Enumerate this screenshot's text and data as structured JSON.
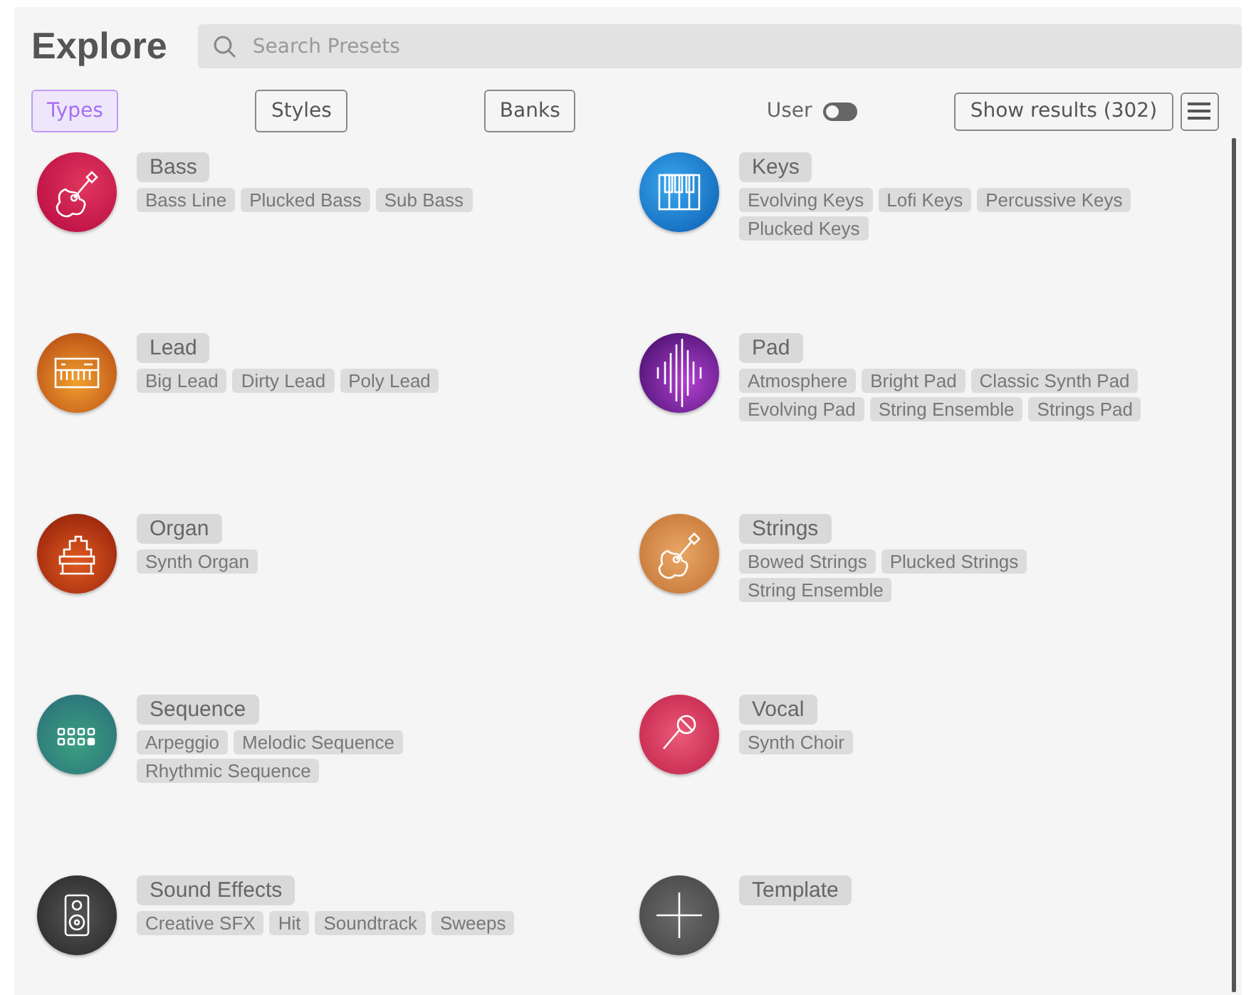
{
  "title": "Explore",
  "search": {
    "placeholder": "Search Presets"
  },
  "filters": [
    {
      "label": "Types",
      "selected": true
    },
    {
      "label": "Styles",
      "selected": false
    },
    {
      "label": "Banks",
      "selected": false
    }
  ],
  "user_toggle": {
    "label": "User",
    "on": false
  },
  "show_results": "Show results (302)",
  "categories": [
    {
      "name": "Bass",
      "kind": "bass",
      "tags": [
        "Bass Line",
        "Plucked Bass",
        "Sub Bass"
      ]
    },
    {
      "name": "Keys",
      "kind": "keys",
      "tags": [
        "Evolving Keys",
        "Lofi Keys",
        "Percussive Keys",
        "Plucked Keys"
      ]
    },
    {
      "name": "Lead",
      "kind": "lead",
      "tags": [
        "Big Lead",
        "Dirty Lead",
        "Poly Lead"
      ]
    },
    {
      "name": "Pad",
      "kind": "pad",
      "tags": [
        "Atmosphere",
        "Bright Pad",
        "Classic Synth Pad",
        "Evolving Pad",
        "String Ensemble",
        "Strings Pad"
      ]
    },
    {
      "name": "Organ",
      "kind": "organ",
      "tags": [
        "Synth Organ"
      ]
    },
    {
      "name": "Strings",
      "kind": "strings",
      "tags": [
        "Bowed Strings",
        "Plucked Strings",
        "String Ensemble"
      ]
    },
    {
      "name": "Sequence",
      "kind": "sequence",
      "tags": [
        "Arpeggio",
        "Melodic Sequence",
        "Rhythmic Sequence"
      ]
    },
    {
      "name": "Vocal",
      "kind": "vocal",
      "tags": [
        "Synth Choir"
      ]
    },
    {
      "name": "Sound Effects",
      "kind": "sfx",
      "tags": [
        "Creative SFX",
        "Hit",
        "Soundtrack",
        "Sweeps"
      ]
    },
    {
      "name": "Template",
      "kind": "template"
    }
  ]
}
